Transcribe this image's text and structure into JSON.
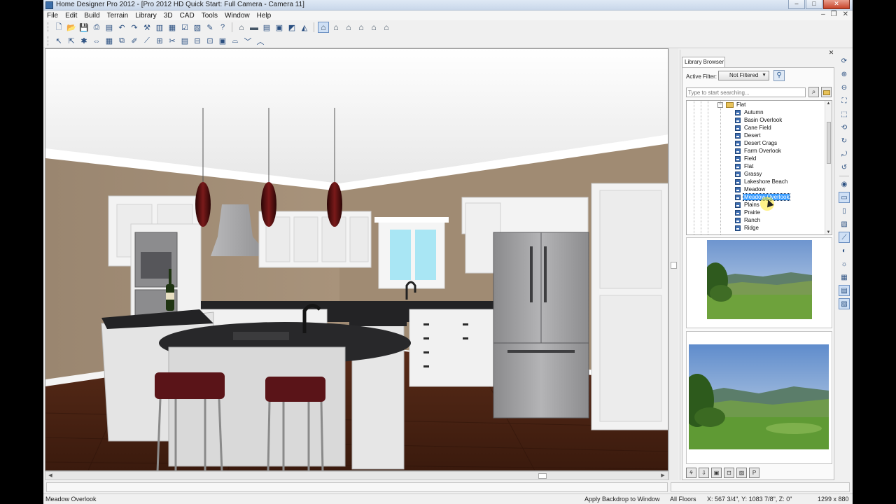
{
  "window": {
    "title": "Home Designer Pro 2012 - [Pro 2012 HD Quick Start: Full Camera - Camera 11]",
    "controls": {
      "minimize": "–",
      "maximize": "□",
      "close": "✕"
    }
  },
  "menu": {
    "items": [
      "File",
      "Edit",
      "Build",
      "Terrain",
      "Library",
      "3D",
      "CAD",
      "Tools",
      "Window",
      "Help"
    ],
    "mdi_controls": {
      "minimize": "–",
      "restore": "❐",
      "close": "✕"
    }
  },
  "library_browser": {
    "tab_label": "Library Browser",
    "close": "✕",
    "active_filter_label": "Active Filter:",
    "active_filter_value": "Not Filtered",
    "search_placeholder": "Type to start searching...",
    "folder_name": "Flat",
    "tree_expander": "−",
    "backdrops": [
      "Autumn",
      "Basin Overlook",
      "Cane Field",
      "Desert",
      "Desert Crags",
      "Farm Overlook",
      "Field",
      "Flat",
      "Grassy",
      "Lakeshore Beach",
      "Meadow",
      "Meadow Overlook",
      "Plains",
      "Prairie",
      "Ranch",
      "Ridge"
    ],
    "selected_item": "Meadow Overlook"
  },
  "status_bar": {
    "selected_name": "Meadow Overlook",
    "action_hint": "Apply Backdrop to Window",
    "floor": "All Floors",
    "coordinates": "X: 567 3/4\", Y: 1083 7/8\", Z: 0\"",
    "view_size": "1299 x 880"
  },
  "colors": {
    "wall": "#9e8870",
    "ceiling": "#eeeeee",
    "floor": "#4a2414",
    "cabinet": "#f2f2f2",
    "countertop": "#2b2b2d",
    "stool_seat": "#5a1418",
    "pendant": "#4c0f0f",
    "selection": "#3399ff"
  }
}
